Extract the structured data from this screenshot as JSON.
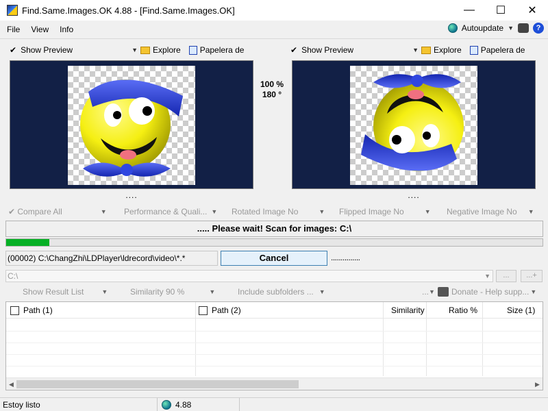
{
  "window": {
    "title": "Find.Same.Images.OK 4.88 - [Find.Same.Images.OK]",
    "controls": [
      "—",
      "☐",
      "✕"
    ]
  },
  "menu": {
    "file": "File",
    "view": "View",
    "info": "Info",
    "autoupdate": "Autoupdate",
    "help": "?"
  },
  "left_pane": {
    "show_preview": "Show Preview",
    "explore": "Explore",
    "papelera": "Papelera de"
  },
  "right_pane": {
    "show_preview": "Show Preview",
    "explore": "Explore",
    "papelera": "Papelera de"
  },
  "preview_info": {
    "zoom": "100 %",
    "rotation": "180 °",
    "dots": "...."
  },
  "options": {
    "compare_all": "Compare All",
    "performance": "Performance & Quali...",
    "rotated": "Rotated Image No",
    "flipped": "Flipped Image No",
    "negative": "Negative Image No"
  },
  "scan": {
    "status": "..... Please wait! Scan for images: C:\\",
    "progress_percent": 8,
    "current_path": "(00002) C:\\ChangZhi\\LDPlayer\\ldrecord\\video\\*.*",
    "cancel": "Cancel",
    "trailing": "..............."
  },
  "path_combo": {
    "value": "C:\\",
    "btn1": "...",
    "btn2": "...+"
  },
  "toolbar": {
    "show_result_list": "Show Result List",
    "similarity": "Similarity 90 %",
    "include_subfolders": "Include subfolders ...",
    "more": "...",
    "donate": "Donate - Help supp..."
  },
  "grid": {
    "columns": [
      "Path (1)",
      "Path (2)",
      "Similarity",
      "Ratio %",
      "Size (1)"
    ]
  },
  "statusbar": {
    "ready": "Estoy listo",
    "version": "4.88"
  },
  "colors": {
    "preview_bg": "#122046",
    "progress": "#06b025",
    "smiley_yellow": "#f5ef12",
    "hat_blue": "#2a3fd8"
  },
  "icons": [
    "app-icon",
    "globe-icon",
    "gear-icon",
    "help-icon",
    "folder-icon",
    "trash-icon",
    "donate-icon"
  ]
}
